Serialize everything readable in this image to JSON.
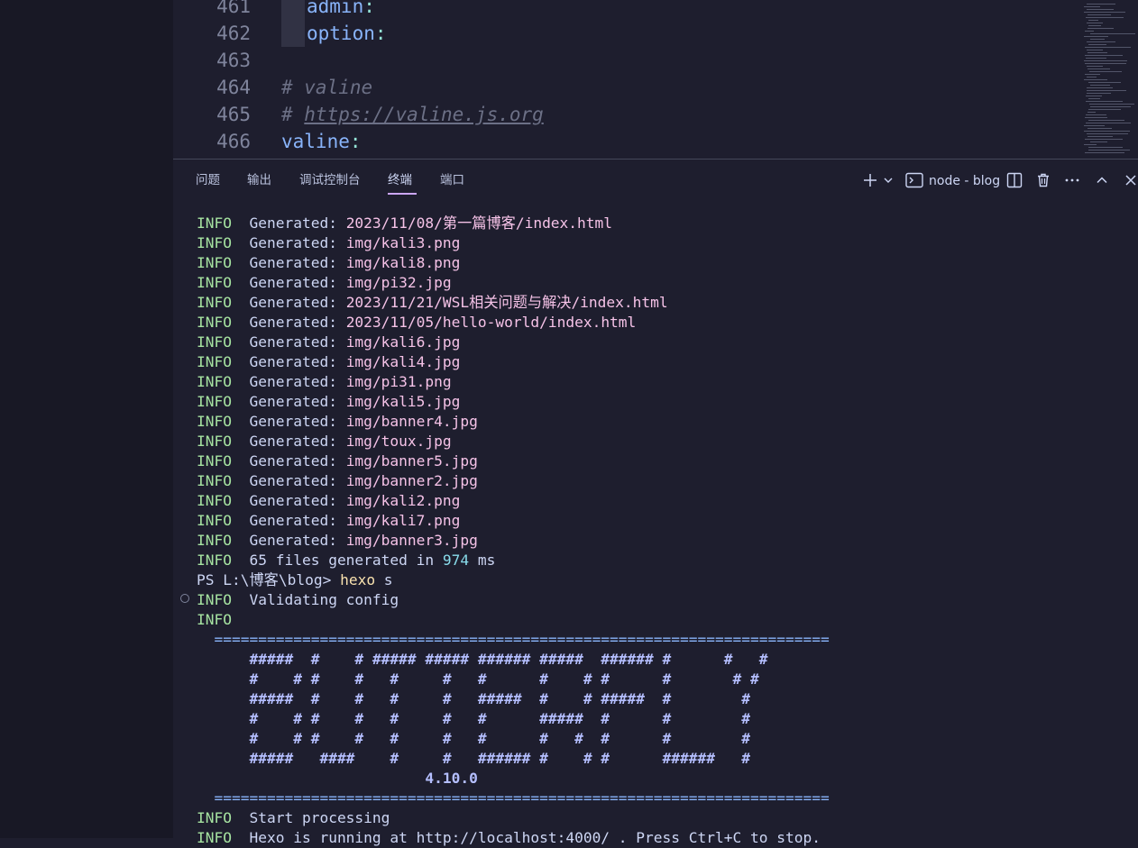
{
  "editor": {
    "lines": [
      {
        "num": "461",
        "key": "admin",
        "sep": ":",
        "indent": true
      },
      {
        "num": "462",
        "key": "option",
        "sep": ":",
        "indent": true
      },
      {
        "num": "463"
      },
      {
        "num": "464",
        "comment": "# valine"
      },
      {
        "num": "465",
        "comment_prefix": "# ",
        "url": "https://valine.js.org"
      },
      {
        "num": "466",
        "key": "valine",
        "sep": ":"
      }
    ]
  },
  "panel": {
    "tabs": [
      "问题",
      "输出",
      "调试控制台",
      "终端",
      "端口"
    ],
    "active_tab": "终端",
    "terminal_name": "node - blog",
    "icons": [
      "plus-icon",
      "chevron-down-icon",
      "terminal-icon",
      "split-icon",
      "trash-icon",
      "ellipsis-icon",
      "chevron-up-icon",
      "close-icon"
    ]
  },
  "terminal": {
    "generated": [
      "2023/11/08/第一篇博客/index.html",
      "img/kali3.png",
      "img/kali8.png",
      "img/pi32.jpg",
      "2023/11/21/WSL相关问题与解决/index.html",
      "2023/11/05/hello-world/index.html",
      "img/kali6.jpg",
      "img/kali4.jpg",
      "img/pi31.png",
      "img/kali5.jpg",
      "img/banner4.jpg",
      "img/toux.jpg",
      "img/banner5.jpg",
      "img/banner2.jpg",
      "img/kali2.png",
      "img/kali7.png",
      "img/banner3.jpg"
    ],
    "level": "INFO",
    "generated_label": "Generated: ",
    "summary_prefix": "65 files generated in ",
    "summary_time": "974",
    "summary_unit": " ms",
    "prompt": "PS L:\\博客\\blog> ",
    "command": "hexo",
    "command_arg": " s",
    "validating": "Validating config",
    "rule": "======================================================================",
    "banner": [
      "#####  #    # ##### ##### ###### #####  ###### #      #   #",
      "#    # #    #   #     #   #      #    # #      #       # #",
      "#####  #    #   #     #   #####  #    # #####  #        #",
      "#    # #    #   #     #   #      #####  #      #        #",
      "#    # #    #   #     #   #      #   #  #      #        #",
      "#####   ####    #     #   ###### #    # #      ######   #"
    ],
    "version": "4.10.0",
    "start": "Start processing",
    "running": "Hexo is running at http://localhost:4000/ . Press Ctrl+C to stop."
  }
}
